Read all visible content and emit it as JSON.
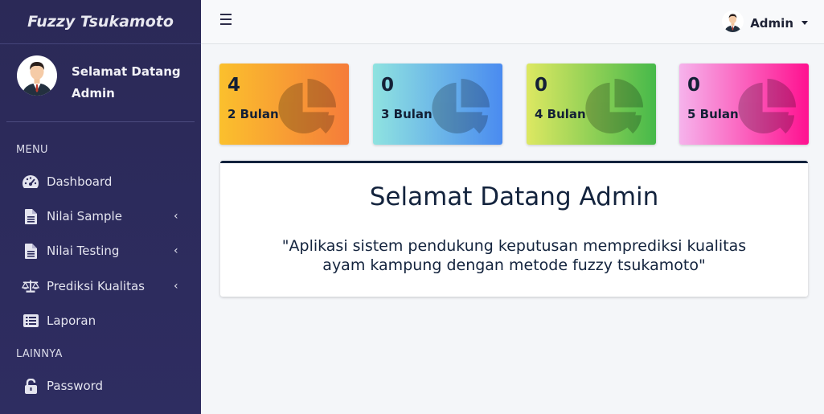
{
  "sidebar": {
    "brand": "Fuzzy Tsukamoto",
    "user_line1": "Selamat Datang",
    "user_line2": "Admin",
    "menu_header": "MENU",
    "other_header": "LAINNYA",
    "items": [
      {
        "label": "Dashboard",
        "icon": "tachometer-icon",
        "has_chevron": false
      },
      {
        "label": "Nilai Sample",
        "icon": "file-icon",
        "has_chevron": true
      },
      {
        "label": "Nilai Testing",
        "icon": "file-icon",
        "has_chevron": true
      },
      {
        "label": "Prediksi Kualitas",
        "icon": "balance-scale-icon",
        "has_chevron": true
      },
      {
        "label": "Laporan",
        "icon": "list-alt-icon",
        "has_chevron": false
      },
      {
        "label": "Password",
        "icon": "unlock-icon",
        "has_chevron": false
      }
    ],
    "chevron": "‹"
  },
  "topbar": {
    "menu_icon": "bars-icon",
    "user_name": "Admin"
  },
  "cards": [
    {
      "value": "4",
      "label": "2 Bulan",
      "gradient": [
        "#fbc02d",
        "#f57c3a"
      ],
      "icon": "pie-chart-icon"
    },
    {
      "value": "0",
      "label": "3 Bulan",
      "gradient": [
        "#8fe3e0",
        "#4a8bf0"
      ],
      "icon": "pie-chart-icon"
    },
    {
      "value": "0",
      "label": "4 Bulan",
      "gradient": [
        "#dde862",
        "#46b94a"
      ],
      "icon": "pie-chart-icon"
    },
    {
      "value": "0",
      "label": "5 Bulan",
      "gradient": [
        "#f6b3ec",
        "#ff1190"
      ],
      "icon": "pie-chart-icon"
    }
  ],
  "welcome": {
    "title": "Selamat Datang Admin",
    "quote": "\"Aplikasi sistem pendukung keputusan memprediksi kualitas ayam kampung dengan metode fuzzy tsukamoto\""
  },
  "colors": {
    "sidebar_bg": "#2b2957",
    "content_bg": "#f4f6f9",
    "text_dark": "#13233d"
  }
}
